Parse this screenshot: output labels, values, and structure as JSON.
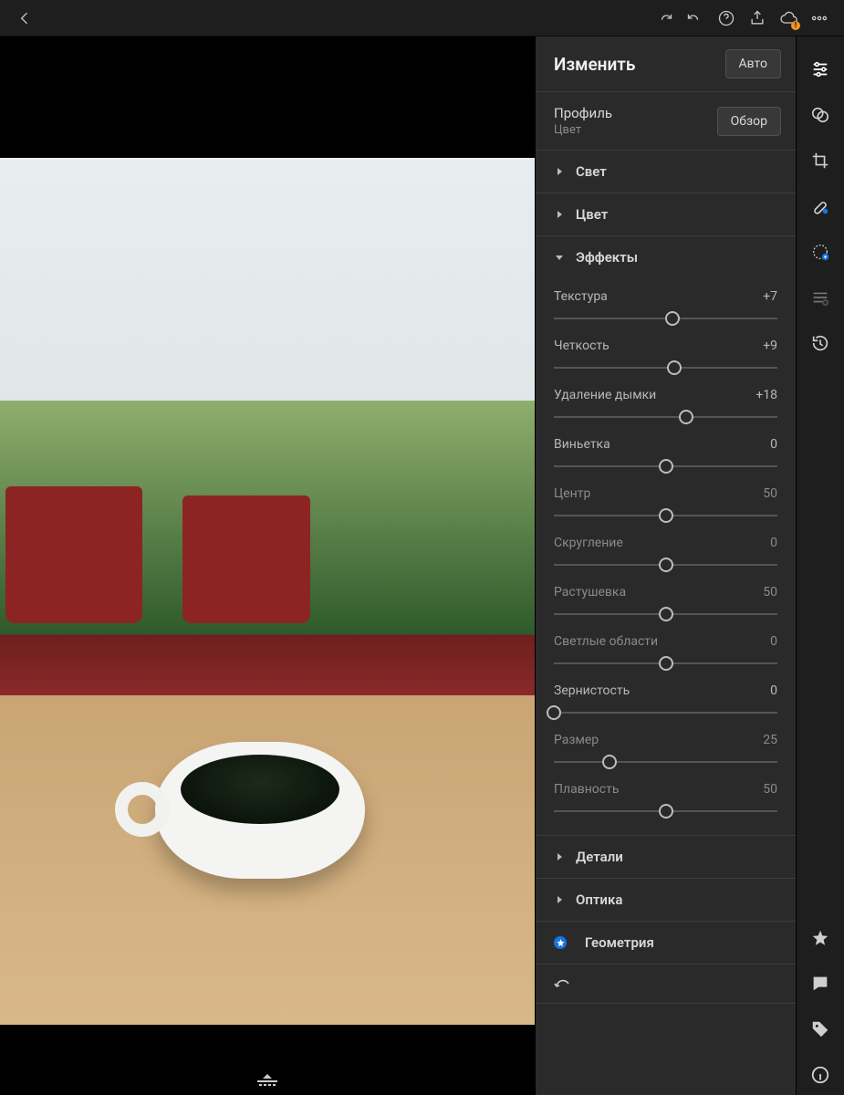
{
  "topbar": {
    "icons": [
      "back",
      "redo",
      "undo",
      "help",
      "share",
      "cloud",
      "more"
    ]
  },
  "panel": {
    "title": "Изменить",
    "auto_label": "Авто",
    "profile": {
      "label": "Профиль",
      "value": "Цвет",
      "browse": "Обзор"
    },
    "sections": {
      "light": "Свет",
      "color": "Цвет",
      "effects": "Эффекты",
      "detail": "Детали",
      "optics": "Оптика",
      "geometry": "Геометрия"
    },
    "effects": [
      {
        "key": "texture",
        "label": "Текстура",
        "value": "+7",
        "pos": 53,
        "dim": false
      },
      {
        "key": "clarity",
        "label": "Четкость",
        "value": "+9",
        "pos": 54,
        "dim": false
      },
      {
        "key": "dehaze",
        "label": "Удаление дымки",
        "value": "+18",
        "pos": 59,
        "dim": false
      },
      {
        "key": "vignette",
        "label": "Виньетка",
        "value": "0",
        "pos": 50,
        "dim": false
      },
      {
        "key": "midpoint",
        "label": "Центр",
        "value": "50",
        "pos": 50,
        "dim": true
      },
      {
        "key": "roundness",
        "label": "Скругление",
        "value": "0",
        "pos": 50,
        "dim": true
      },
      {
        "key": "feather",
        "label": "Растушевка",
        "value": "50",
        "pos": 50,
        "dim": true
      },
      {
        "key": "highlights",
        "label": "Светлые области",
        "value": "0",
        "pos": 50,
        "dim": true
      },
      {
        "key": "grain",
        "label": "Зернистость",
        "value": "0",
        "pos": 0,
        "dim": false
      },
      {
        "key": "size",
        "label": "Размер",
        "value": "25",
        "pos": 25,
        "dim": true
      },
      {
        "key": "smoothness",
        "label": "Плавность",
        "value": "50",
        "pos": 50,
        "dim": true
      }
    ]
  },
  "rail": {
    "items": [
      "edit",
      "presets",
      "crop",
      "healing",
      "mask",
      "versions",
      "history"
    ],
    "bottom": [
      "star",
      "comment",
      "tag",
      "info"
    ]
  }
}
